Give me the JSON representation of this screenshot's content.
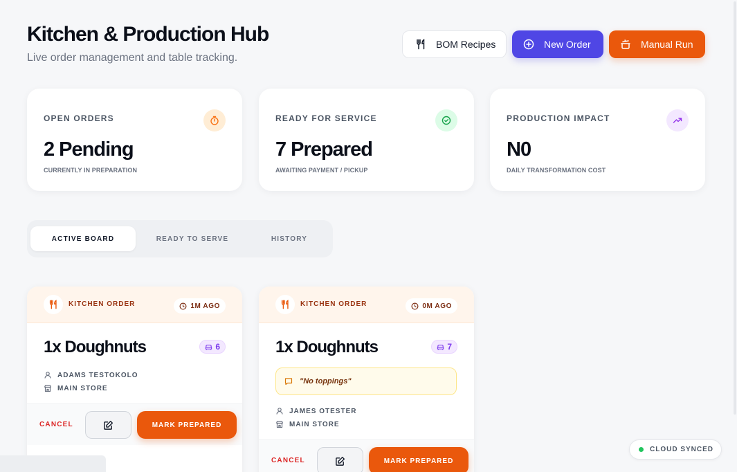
{
  "header": {
    "title": "Kitchen & Production Hub",
    "subtitle": "Live order management and table tracking."
  },
  "actions": {
    "bom_label": "BOM Recipes",
    "new_order_label": "New Order",
    "manual_run_label": "Manual Run"
  },
  "stats": [
    {
      "label": "OPEN ORDERS",
      "value": "2 Pending",
      "sub": "CURRENTLY IN PREPARATION",
      "icon": "timer-icon",
      "color": "#f97316"
    },
    {
      "label": "READY FOR SERVICE",
      "value": "7 Prepared",
      "sub": "AWAITING PAYMENT / PICKUP",
      "icon": "check-circle-icon",
      "color": "#16a34a"
    },
    {
      "label": "PRODUCTION IMPACT",
      "value": "N0",
      "sub": "DAILY TRANSFORMATION COST",
      "icon": "trending-up-icon",
      "color": "#9333ea"
    }
  ],
  "tabs": [
    {
      "label": "ACTIVE BOARD",
      "active": true
    },
    {
      "label": "READY TO SERVE",
      "active": false
    },
    {
      "label": "HISTORY",
      "active": false
    }
  ],
  "orders": [
    {
      "kind": "KITCHEN ORDER",
      "ago": "1M AGO",
      "item": "1x Doughnuts",
      "table": "6",
      "note": "",
      "customer": "ADAMS TESTOKOLO",
      "store": "MAIN STORE",
      "cancel_label": "CANCEL",
      "mark_label": "MARK PREPARED"
    },
    {
      "kind": "KITCHEN ORDER",
      "ago": "0M AGO",
      "item": "1x Doughnuts",
      "table": "7",
      "note": "\"No toppings\"",
      "customer": "JAMES OTESTER",
      "store": "MAIN STORE",
      "cancel_label": "CANCEL",
      "mark_label": "MARK PREPARED"
    }
  ],
  "status": {
    "sync_label": "CLOUD SYNCED",
    "sync_color": "#22c55e"
  },
  "colors": {
    "primary": "#4f46e5",
    "accent": "#ea580c",
    "danger": "#dc2626"
  }
}
